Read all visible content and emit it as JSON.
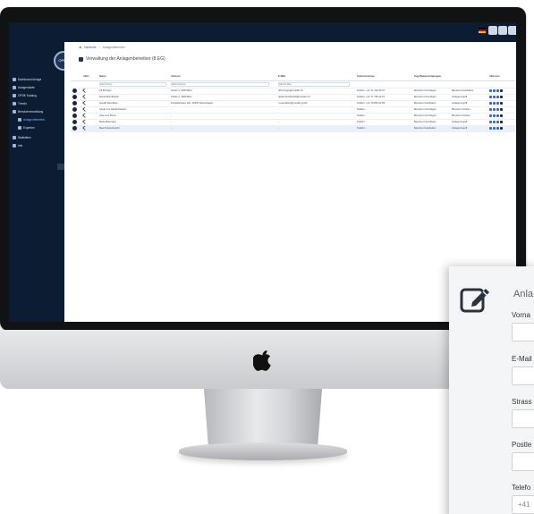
{
  "app": {
    "logo_text": "OPDE",
    "breadcrumb": [
      "Startseite",
      "Anlagenbetreiber"
    ],
    "page_title": "Verwaltung der Anlagenbetreiber (8 EG)"
  },
  "sidebar": {
    "items": [
      {
        "label": "Dashboard Anlage",
        "icon": "chart-icon"
      },
      {
        "label": "Anlagenkarte",
        "icon": "map-icon"
      },
      {
        "label": "OPDE Katalog",
        "icon": "catalog-icon"
      },
      {
        "label": "Trends",
        "icon": "trend-icon"
      },
      {
        "label": "Benutzerverwaltung",
        "icon": "users-icon"
      },
      {
        "label": "Anlagenbetreiber",
        "icon": "operator-icon"
      },
      {
        "label": "Experten",
        "icon": "expert-icon"
      },
      {
        "label": "Statistiken",
        "icon": "stats-icon"
      },
      {
        "label": "Info",
        "icon": "info-icon"
      }
    ]
  },
  "table": {
    "columns": [
      "",
      "Aktiv",
      "Name",
      "Adresse",
      "E-Mail",
      "Telefonnummer",
      "Zugriffsberechtigungen",
      "",
      "Aktionen"
    ],
    "filter_placeholders": [
      "Nach Name",
      "Nach Adresse",
      "Nach E-Mail"
    ],
    "rows": [
      {
        "name": "Ulf Brunger",
        "address": "Teststr.1, 3000 Bern",
        "email": "ulf.brunger@mueller.ch",
        "phone": "Telefon: +41 71 123 45 67",
        "perm1": "Benutzer hinzufügen",
        "perm2": "Benutzer bearbeiten"
      },
      {
        "name": "Daniel Burckhardt",
        "address": "Teststr.1, 3000 Bern",
        "email": "daniel.burckhardt@mueller.ch",
        "phone": "Telefon: +41 71 765 43 21",
        "perm1": "Benutzer hinzufügen",
        "perm2": "Anlagenzugriff"
      },
      {
        "name": "Gerald Rüschlein",
        "address": "Ponkelstrasse 12b, 15326 Rosenhagen",
        "email": "r.rueschlein@mueller.gmbh",
        "phone": "Telefon: +41 79 854 20 55",
        "perm1": "Benutzer bearbeiten",
        "perm2": "Anlagenzugriff"
      },
      {
        "name": "Serge von Niederhäusern",
        "address": "-",
        "email": "-",
        "phone": "Telefon: -",
        "perm1": "Benutzer hinzufügen",
        "perm2": "Benutzer löschen"
      },
      {
        "name": "Jean-Luc Pierre",
        "address": "-",
        "email": "-",
        "phone": "Telefon: -",
        "perm1": "Benutzer hinzufügen",
        "perm2": "Benutzer löschen"
      },
      {
        "name": "Maria Baumann",
        "address": "-",
        "email": "-",
        "phone": "Telefon: -",
        "perm1": "Benutzer hinzufügen",
        "perm2": "Anlagenzugriff"
      },
      {
        "name": "Beat Frauenknecht",
        "address": "-",
        "email": "-",
        "phone": "Telefon: -",
        "perm1": "Benutzer bearbeiten",
        "perm2": "Anlagenzugriff"
      }
    ]
  },
  "form_card": {
    "title": "Anla",
    "fields": [
      {
        "label": "Vorna",
        "value": ""
      },
      {
        "label": "E-Mail",
        "value": ""
      },
      {
        "label": "Strass",
        "value": ""
      },
      {
        "label": "Postle",
        "value": ""
      },
      {
        "label": "Telefo",
        "value": "+41"
      }
    ]
  },
  "colors": {
    "sidebar_bg": "#0b1c33",
    "accent": "#2b6bd1"
  }
}
